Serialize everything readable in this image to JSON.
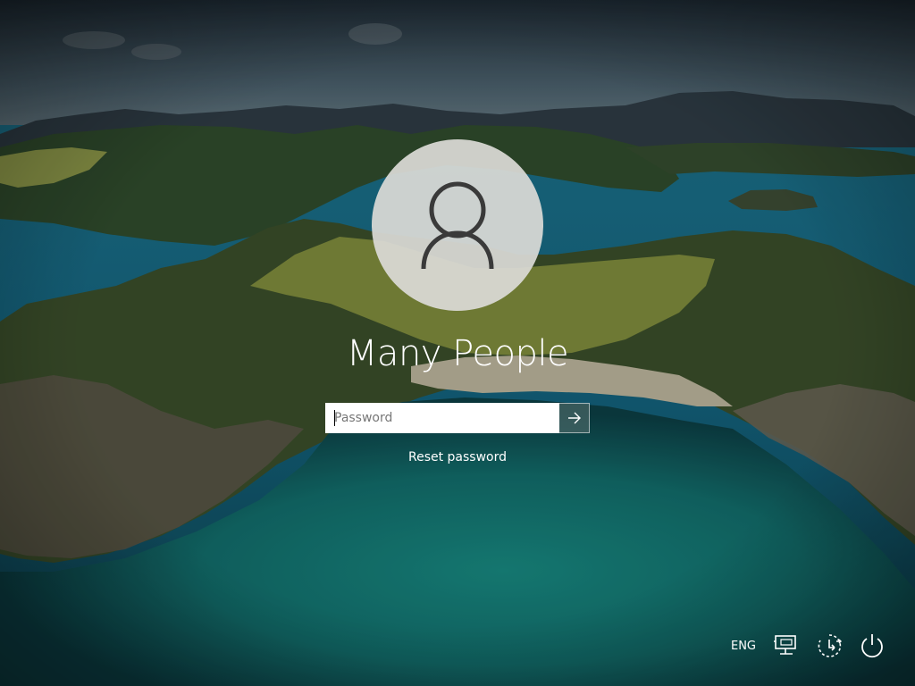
{
  "user": {
    "display_name": "Many People",
    "avatar_icon": "user-silhouette-icon"
  },
  "login": {
    "password_placeholder": "Password",
    "password_value": "",
    "submit_icon": "arrow-right-icon",
    "reset_password_label": "Reset password"
  },
  "tray": {
    "language": "ENG",
    "network_icon": "network-icon",
    "accessibility_icon": "ease-of-access-icon",
    "power_icon": "power-icon"
  },
  "colors": {
    "text": "#ffffff",
    "avatar_bg": "#dadad6",
    "submit_bg": "#466464"
  }
}
